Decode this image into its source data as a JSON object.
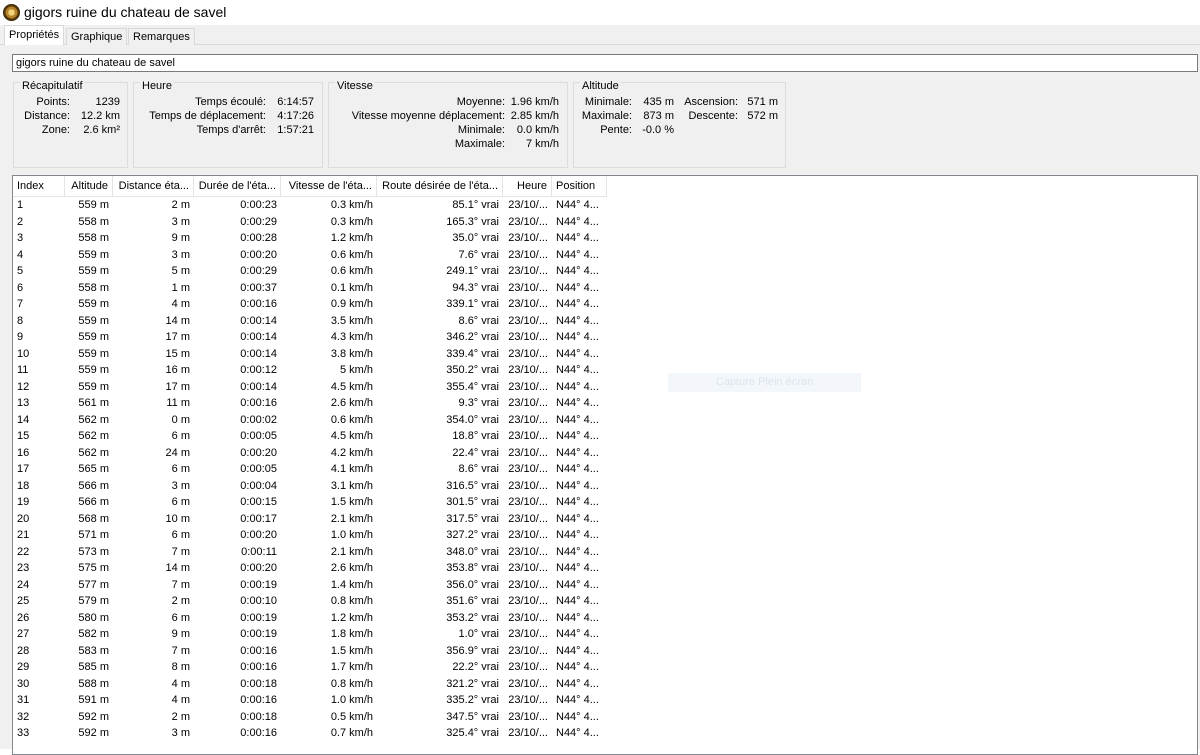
{
  "window": {
    "title": "gigors ruine du chateau de savel"
  },
  "tabs": [
    {
      "label": "Propriétés",
      "active": true
    },
    {
      "label": "Graphique",
      "active": false
    },
    {
      "label": "Remarques",
      "active": false
    }
  ],
  "name_field": {
    "value": "gigors ruine du chateau de savel"
  },
  "groups": {
    "recap": {
      "title": "Récapitulatif",
      "rows": [
        {
          "label": "Points:",
          "value": "1239"
        },
        {
          "label": "Distance:",
          "value": "12.2 km"
        },
        {
          "label": "Zone:",
          "value": "2.6 km²"
        }
      ]
    },
    "heure": {
      "title": "Heure",
      "rows": [
        {
          "label": "Temps écoulé:",
          "value": "6:14:57"
        },
        {
          "label": "Temps de déplacement:",
          "value": "4:17:26"
        },
        {
          "label": "Temps d'arrêt:",
          "value": "1:57:21"
        }
      ]
    },
    "vitesse": {
      "title": "Vitesse",
      "rows": [
        {
          "label": "Moyenne:",
          "value": "1.96 km/h"
        },
        {
          "label": "Vitesse moyenne déplacement:",
          "value": "2.85 km/h"
        },
        {
          "label": "Minimale:",
          "value": "0.0 km/h"
        },
        {
          "label": "Maximale:",
          "value": "7 km/h"
        }
      ]
    },
    "altitude": {
      "title": "Altitude",
      "rows": [
        {
          "label": "Minimale:",
          "value": "435 m",
          "label2": "Ascension:",
          "value2": "571 m"
        },
        {
          "label": "Maximale:",
          "value": "873 m",
          "label2": "Descente:",
          "value2": "572 m"
        },
        {
          "label": "Pente:",
          "value": "-0.0 %"
        }
      ]
    }
  },
  "table": {
    "headers": [
      "Index",
      "Altitude",
      "Distance éta...",
      "Durée de l'éta...",
      "Vitesse de l'éta...",
      "Route désirée de l'éta...",
      "Heure",
      "Position"
    ],
    "rows": [
      [
        "1",
        "559 m",
        "2 m",
        "0:00:23",
        "0.3 km/h",
        "85.1° vrai",
        "23/10/...",
        "N44° 4..."
      ],
      [
        "2",
        "558 m",
        "3 m",
        "0:00:29",
        "0.3 km/h",
        "165.3° vrai",
        "23/10/...",
        "N44° 4..."
      ],
      [
        "3",
        "558 m",
        "9 m",
        "0:00:28",
        "1.2 km/h",
        "35.0° vrai",
        "23/10/...",
        "N44° 4..."
      ],
      [
        "4",
        "559 m",
        "3 m",
        "0:00:20",
        "0.6 km/h",
        "7.6° vrai",
        "23/10/...",
        "N44° 4..."
      ],
      [
        "5",
        "559 m",
        "5 m",
        "0:00:29",
        "0.6 km/h",
        "249.1° vrai",
        "23/10/...",
        "N44° 4..."
      ],
      [
        "6",
        "558 m",
        "1 m",
        "0:00:37",
        "0.1 km/h",
        "94.3° vrai",
        "23/10/...",
        "N44° 4..."
      ],
      [
        "7",
        "559 m",
        "4 m",
        "0:00:16",
        "0.9 km/h",
        "339.1° vrai",
        "23/10/...",
        "N44° 4..."
      ],
      [
        "8",
        "559 m",
        "14 m",
        "0:00:14",
        "3.5 km/h",
        "8.6° vrai",
        "23/10/...",
        "N44° 4..."
      ],
      [
        "9",
        "559 m",
        "17 m",
        "0:00:14",
        "4.3 km/h",
        "346.2° vrai",
        "23/10/...",
        "N44° 4..."
      ],
      [
        "10",
        "559 m",
        "15 m",
        "0:00:14",
        "3.8 km/h",
        "339.4° vrai",
        "23/10/...",
        "N44° 4..."
      ],
      [
        "11",
        "559 m",
        "16 m",
        "0:00:12",
        "5 km/h",
        "350.2° vrai",
        "23/10/...",
        "N44° 4..."
      ],
      [
        "12",
        "559 m",
        "17 m",
        "0:00:14",
        "4.5 km/h",
        "355.4° vrai",
        "23/10/...",
        "N44° 4..."
      ],
      [
        "13",
        "561 m",
        "11 m",
        "0:00:16",
        "2.6 km/h",
        "9.3° vrai",
        "23/10/...",
        "N44° 4..."
      ],
      [
        "14",
        "562 m",
        "0 m",
        "0:00:02",
        "0.6 km/h",
        "354.0° vrai",
        "23/10/...",
        "N44° 4..."
      ],
      [
        "15",
        "562 m",
        "6 m",
        "0:00:05",
        "4.5 km/h",
        "18.8° vrai",
        "23/10/...",
        "N44° 4..."
      ],
      [
        "16",
        "562 m",
        "24 m",
        "0:00:20",
        "4.2 km/h",
        "22.4° vrai",
        "23/10/...",
        "N44° 4..."
      ],
      [
        "17",
        "565 m",
        "6 m",
        "0:00:05",
        "4.1 km/h",
        "8.6° vrai",
        "23/10/...",
        "N44° 4..."
      ],
      [
        "18",
        "566 m",
        "3 m",
        "0:00:04",
        "3.1 km/h",
        "316.5° vrai",
        "23/10/...",
        "N44° 4..."
      ],
      [
        "19",
        "566 m",
        "6 m",
        "0:00:15",
        "1.5 km/h",
        "301.5° vrai",
        "23/10/...",
        "N44° 4..."
      ],
      [
        "20",
        "568 m",
        "10 m",
        "0:00:17",
        "2.1 km/h",
        "317.5° vrai",
        "23/10/...",
        "N44° 4..."
      ],
      [
        "21",
        "571 m",
        "6 m",
        "0:00:20",
        "1.0 km/h",
        "327.2° vrai",
        "23/10/...",
        "N44° 4..."
      ],
      [
        "22",
        "573 m",
        "7 m",
        "0:00:11",
        "2.1 km/h",
        "348.0° vrai",
        "23/10/...",
        "N44° 4..."
      ],
      [
        "23",
        "575 m",
        "14 m",
        "0:00:20",
        "2.6 km/h",
        "353.8° vrai",
        "23/10/...",
        "N44° 4..."
      ],
      [
        "24",
        "577 m",
        "7 m",
        "0:00:19",
        "1.4 km/h",
        "356.0° vrai",
        "23/10/...",
        "N44° 4..."
      ],
      [
        "25",
        "579 m",
        "2 m",
        "0:00:10",
        "0.8 km/h",
        "351.6° vrai",
        "23/10/...",
        "N44° 4..."
      ],
      [
        "26",
        "580 m",
        "6 m",
        "0:00:19",
        "1.2 km/h",
        "353.2° vrai",
        "23/10/...",
        "N44° 4..."
      ],
      [
        "27",
        "582 m",
        "9 m",
        "0:00:19",
        "1.8 km/h",
        "1.0° vrai",
        "23/10/...",
        "N44° 4..."
      ],
      [
        "28",
        "583 m",
        "7 m",
        "0:00:16",
        "1.5 km/h",
        "356.9° vrai",
        "23/10/...",
        "N44° 4..."
      ],
      [
        "29",
        "585 m",
        "8 m",
        "0:00:16",
        "1.7 km/h",
        "22.2° vrai",
        "23/10/...",
        "N44° 4..."
      ],
      [
        "30",
        "588 m",
        "4 m",
        "0:00:18",
        "0.8 km/h",
        "321.2° vrai",
        "23/10/...",
        "N44° 4..."
      ],
      [
        "31",
        "591 m",
        "4 m",
        "0:00:16",
        "1.0 km/h",
        "335.2° vrai",
        "23/10/...",
        "N44° 4..."
      ],
      [
        "32",
        "592 m",
        "2 m",
        "0:00:18",
        "0.5 km/h",
        "347.5° vrai",
        "23/10/...",
        "N44° 4..."
      ],
      [
        "33",
        "592 m",
        "3 m",
        "0:00:16",
        "0.7 km/h",
        "325.4° vrai",
        "23/10/...",
        "N44° 4..."
      ]
    ]
  },
  "ghost_label": "Capture Plein écran"
}
